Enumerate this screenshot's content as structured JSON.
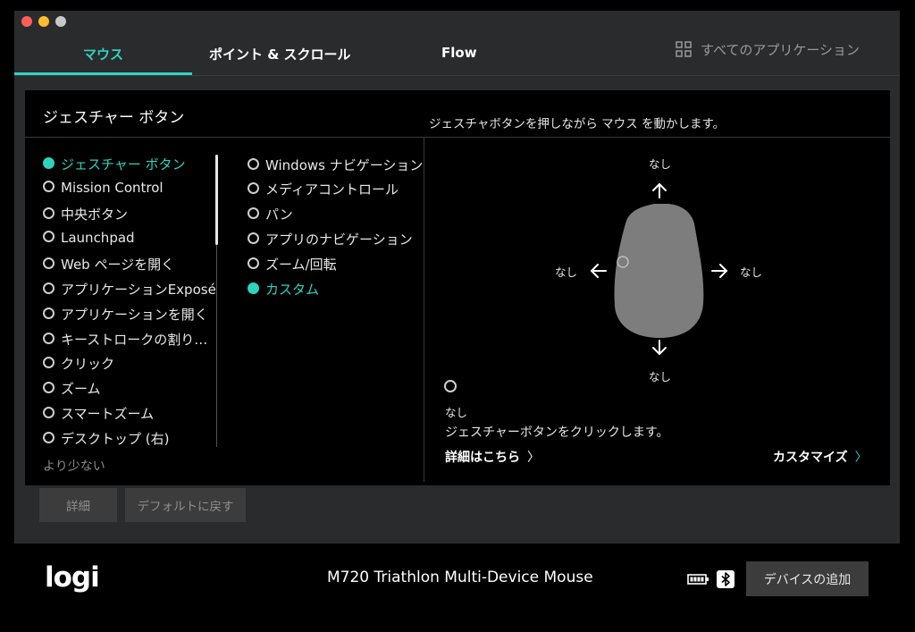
{
  "tabs": [
    {
      "label": "マウス",
      "active": true
    },
    {
      "label": "ポイント & スクロール",
      "active": false
    },
    {
      "label": "Flow",
      "active": false
    }
  ],
  "all_apps_label": "すべてのアプリケーション",
  "panel": {
    "title": "ジェスチャー ボタン",
    "description": "ジェスチャボタンを押しながら マウス を動かします。"
  },
  "options_col1": [
    {
      "label": "ジェスチャー ボタン",
      "selected": true
    },
    {
      "label": "Mission Control",
      "selected": false
    },
    {
      "label": "中央ボタン",
      "selected": false
    },
    {
      "label": "Launchpad",
      "selected": false
    },
    {
      "label": "Web ページを開く",
      "selected": false
    },
    {
      "label": "アプリケーションExposé",
      "selected": false
    },
    {
      "label": "アプリケーションを開く",
      "selected": false
    },
    {
      "label": "キーストロークの割り…",
      "selected": false
    },
    {
      "label": "クリック",
      "selected": false
    },
    {
      "label": "ズーム",
      "selected": false
    },
    {
      "label": "スマートズーム",
      "selected": false
    },
    {
      "label": "デスクトップ (右)",
      "selected": false
    }
  ],
  "options_col2": [
    {
      "label": "Windows ナビゲーション",
      "selected": false
    },
    {
      "label": "メディアコントロール",
      "selected": false
    },
    {
      "label": "パン",
      "selected": false
    },
    {
      "label": "アプリのナビゲーション",
      "selected": false
    },
    {
      "label": "ズーム/回転",
      "selected": false
    },
    {
      "label": "カスタム",
      "selected": true
    }
  ],
  "fewer_label": "より少ない",
  "diagram": {
    "up": "なし",
    "down": "なし",
    "left": "なし",
    "right": "なし"
  },
  "click_action": {
    "value": "なし",
    "description": "ジェスチャーボタンをクリックします。"
  },
  "more_link": "詳細はこちら",
  "customize_link": "カスタマイズ",
  "buttons": {
    "details": "詳細",
    "reset": "デフォルトに戻す"
  },
  "footer": {
    "logo": "logi",
    "device_name": "M720 Triathlon Multi-Device Mouse",
    "add_device": "デバイスの追加"
  },
  "colors": {
    "accent": "#2dd4c0",
    "window_bg": "#2a2b2c",
    "panel_bg": "#000000"
  },
  "icons": [
    "apps-grid-icon",
    "battery-icon",
    "bluetooth-icon",
    "chevron-right-icon",
    "arrow-up-icon",
    "arrow-down-icon",
    "arrow-left-icon",
    "arrow-right-icon"
  ]
}
